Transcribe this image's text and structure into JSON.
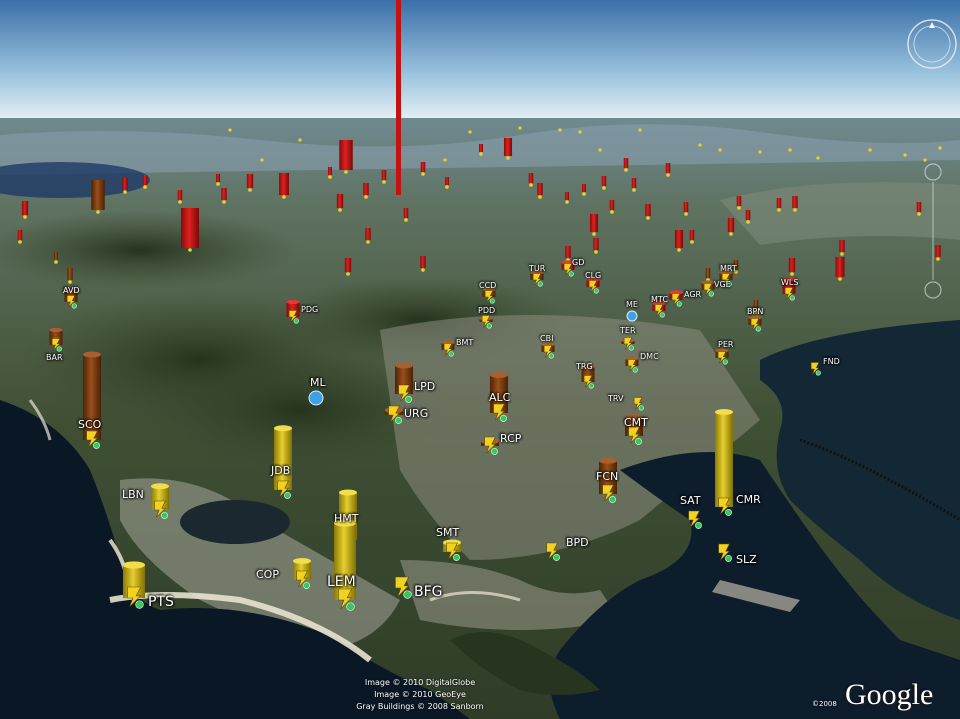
{
  "map": {
    "view": "3d-tilted-earth",
    "colors": {
      "sky_top": "#3a6fa8",
      "sky_horizon": "#e6f0f5",
      "sea": "#0c1e30",
      "lagoon": "#1d2a30",
      "beach": "#e8e2cf",
      "terrain": "#3c4c32",
      "city": "#b7b2a8"
    },
    "marker_colors": {
      "red": "#c41212",
      "brown": "#7a3a10",
      "yellow": "#c9b21a",
      "station_icon": "#f2d21e",
      "pin_icon": "#3ea0e6",
      "green_dot": "#35c95a"
    }
  },
  "stations": [
    {
      "code": "PTS",
      "color": "yellow",
      "h": 0.3
    },
    {
      "code": "LBN",
      "color": "yellow",
      "h": 0.25
    },
    {
      "code": "COP",
      "color": "yellow",
      "h": 0.2
    },
    {
      "code": "LEM",
      "color": "yellow",
      "h": 0.7
    },
    {
      "code": "HMT",
      "color": "yellow",
      "h": 0.5
    },
    {
      "code": "BFG",
      "color": "yellow",
      "h": 0.0
    },
    {
      "code": "SMT",
      "color": "yellow",
      "h": 0.1
    },
    {
      "code": "BPD",
      "color": "yellow",
      "h": 0.0
    },
    {
      "code": "JDB",
      "color": "yellow",
      "h": 0.65
    },
    {
      "code": "SCO",
      "color": "brown",
      "h": 0.9
    },
    {
      "code": "FCN",
      "color": "brown",
      "h": 0.35
    },
    {
      "code": "SAT",
      "color": "brown",
      "h": 0.0
    },
    {
      "code": "CMR",
      "color": "yellow",
      "h": 1.0
    },
    {
      "code": "SLZ",
      "color": "yellow",
      "h": 0.0
    },
    {
      "code": "CMT",
      "color": "brown",
      "h": 0.2
    },
    {
      "code": "TRV",
      "color": "brown",
      "h": 0.0
    },
    {
      "code": "RCP",
      "color": "brown",
      "h": 0.05
    },
    {
      "code": "ALC",
      "color": "brown",
      "h": 0.4
    },
    {
      "code": "URG",
      "color": "brown",
      "h": 0.05
    },
    {
      "code": "LPD",
      "color": "brown",
      "h": 0.3
    },
    {
      "code": "TRG",
      "color": "brown",
      "h": 0.2
    },
    {
      "code": "CBI",
      "color": "brown",
      "h": 0.1
    },
    {
      "code": "BMT",
      "color": "brown",
      "h": 0.1
    },
    {
      "code": "DMC",
      "color": "brown",
      "h": 0.1
    },
    {
      "code": "TER",
      "color": "brown",
      "h": 0.05
    },
    {
      "code": "PER",
      "color": "brown",
      "h": 0.1
    },
    {
      "code": "FND",
      "color": "yellow",
      "h": 0.0
    },
    {
      "code": "BPN",
      "color": "brown",
      "h": 0.1
    },
    {
      "code": "BAR",
      "color": "brown",
      "h": 0.2
    },
    {
      "code": "AVD",
      "color": "brown",
      "h": 0.15
    },
    {
      "code": "PDG",
      "color": "red",
      "h": 0.2
    },
    {
      "code": "PDD",
      "color": "brown",
      "h": 0.05
    },
    {
      "code": "CCD",
      "color": "brown",
      "h": 0.1
    },
    {
      "code": "TUR",
      "color": "brown",
      "h": 0.1
    },
    {
      "code": "GD",
      "color": "red",
      "h": 0.1
    },
    {
      "code": "CLG",
      "color": "red",
      "h": 0.1
    },
    {
      "code": "MTC",
      "color": "red",
      "h": 0.1
    },
    {
      "code": "AGR",
      "color": "red",
      "h": 0.1
    },
    {
      "code": "MRT",
      "color": "brown",
      "h": 0.1
    },
    {
      "code": "VGE",
      "color": "brown",
      "h": 0.1
    },
    {
      "code": "WLS",
      "color": "red",
      "h": 0.2
    }
  ],
  "pins": [
    {
      "code": "ML"
    },
    {
      "code": "ME"
    }
  ],
  "credits": [
    "Image © 2010 DigitalGlobe",
    "Image © 2010 GeoEye",
    "Gray Buildings © 2008 Sanborn"
  ],
  "copyright_year": "©2008",
  "logo": "Google",
  "icons": {
    "compass": "compass-ring-icon",
    "zoom": "zoom-slider-icon",
    "station": "lightning-station-icon",
    "pin": "placemark-pin-icon"
  }
}
